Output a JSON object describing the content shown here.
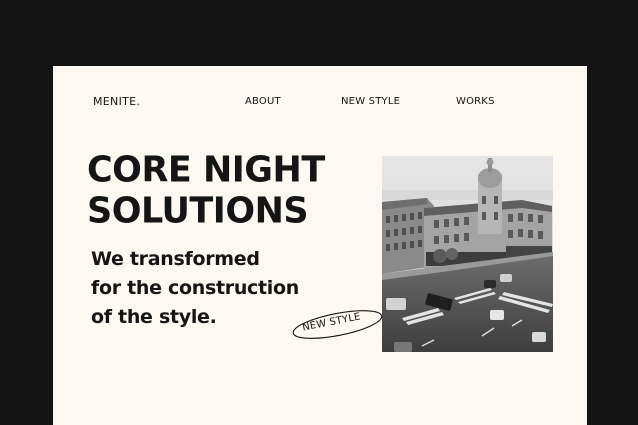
{
  "brand": {
    "logo": "MENITE."
  },
  "nav": {
    "about": "ABOUT",
    "new_style": "NEW STYLE",
    "works": "WORKS"
  },
  "hero": {
    "headline_line1": "CORE NIGHT",
    "headline_line2": "SOLUTIONS",
    "sub_line1": "We transformed",
    "sub_line2": "for the construction",
    "sub_line3": "of the style."
  },
  "badge": {
    "label": "NEW STYLE"
  },
  "colors": {
    "background": "#141314",
    "card": "#fdf8f1",
    "text": "#151515"
  },
  "image": {
    "icon": "city-street-photo",
    "style": "black-and-white"
  }
}
